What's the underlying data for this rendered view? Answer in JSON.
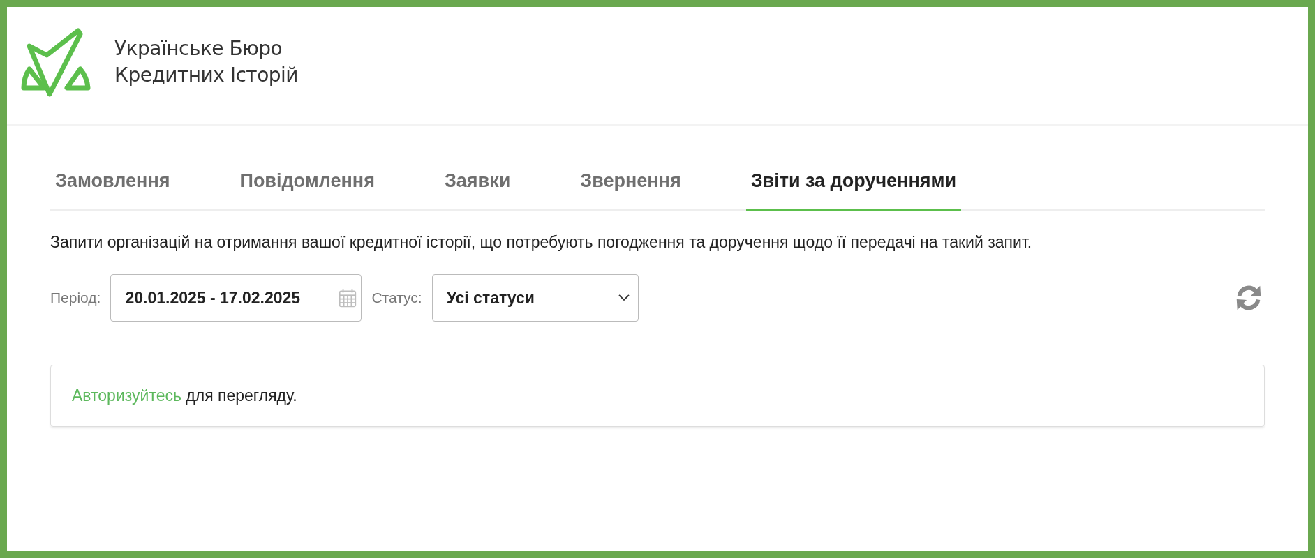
{
  "header": {
    "logo_lines": [
      "Українське Бюро",
      "Кредитних Історій"
    ]
  },
  "tabs": [
    {
      "label": "Замовлення",
      "selected": false
    },
    {
      "label": "Повідомлення",
      "selected": false
    },
    {
      "label": "Заявки",
      "selected": false
    },
    {
      "label": "Звернення",
      "selected": false
    },
    {
      "label": "Звіти за дорученнями",
      "selected": true
    }
  ],
  "description": "Запити організацій на отримання вашої кредитної історії, що потребують погодження та доручення щодо її передачі на такий запит.",
  "filters": {
    "period_label": "Період:",
    "period_value": "20.01.2025 - 17.02.2025",
    "status_label": "Статус:",
    "status_value": "Усі статуси"
  },
  "message": {
    "link": "Авторизуйтесь",
    "text": "для перегляду."
  }
}
